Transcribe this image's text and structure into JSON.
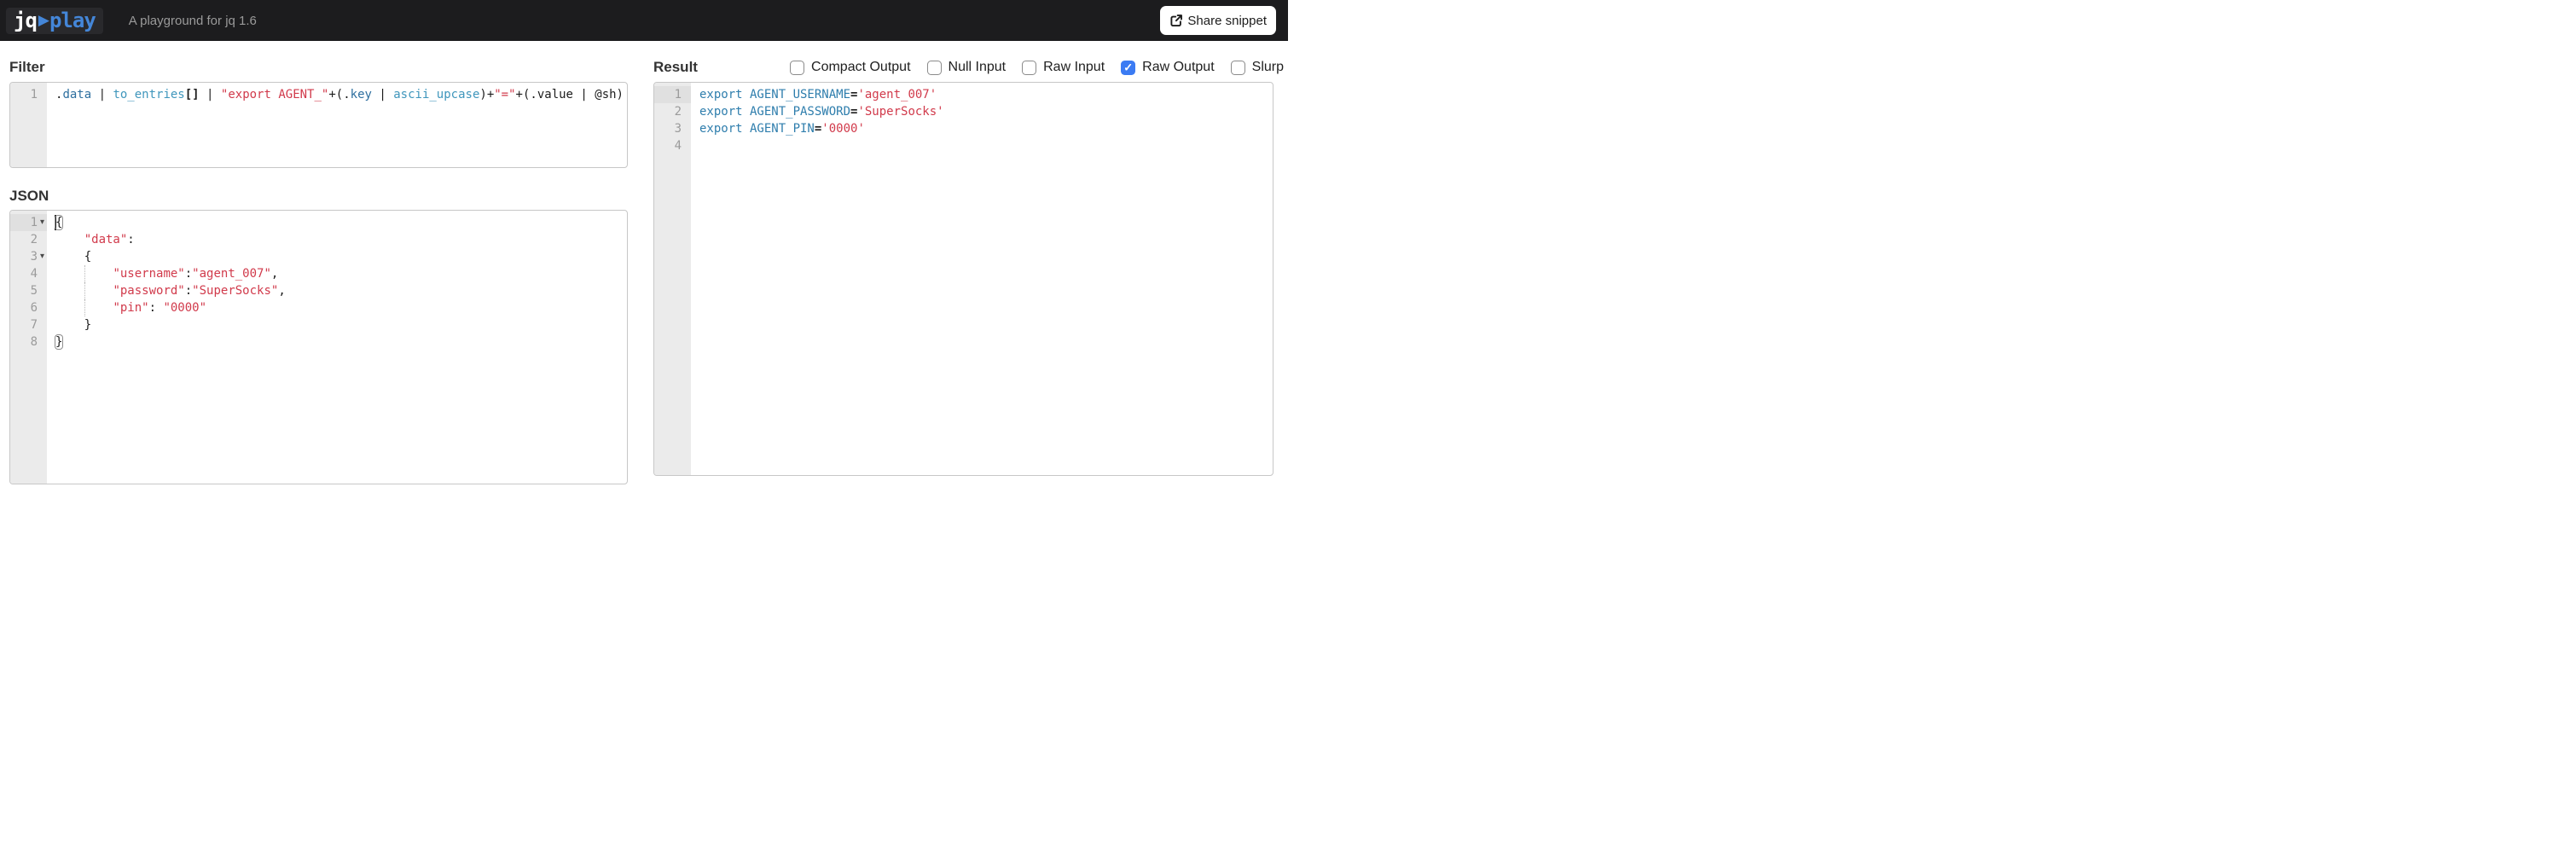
{
  "navbar": {
    "logo_jq": "jq",
    "logo_arrow": "▶",
    "logo_play": "play",
    "tagline": "A playground for jq 1.6",
    "share_button_label": "Share snippet"
  },
  "colors": {
    "navbar_bg": "#1c1c1e",
    "logo_blue": "#4486d8",
    "string_red": "#d13a4b",
    "field_blue": "#2e6f9f",
    "builtin_blue": "#3f96bc",
    "shell_blue": "#2f7ead",
    "checkbox_checked_blue": "#3b7bf3",
    "gutter_gray": "#ebebeb"
  },
  "filter": {
    "heading": "Filter",
    "editor": {
      "lines": [
        {
          "n": "1",
          "tokens": [
            {
              "t": ".",
              "c": ""
            },
            {
              "t": "data",
              "c": "b1"
            },
            {
              "t": " | ",
              "c": ""
            },
            {
              "t": "to_entries",
              "c": "b2"
            },
            {
              "t": "[]",
              "c": "bb"
            },
            {
              "t": " | ",
              "c": ""
            },
            {
              "t": "\"export AGENT_\"",
              "c": "r"
            },
            {
              "t": "+(.",
              "c": ""
            },
            {
              "t": "key",
              "c": "b1"
            },
            {
              "t": " | ",
              "c": ""
            },
            {
              "t": "ascii_upcase",
              "c": "b2"
            },
            {
              "t": ")+",
              "c": ""
            },
            {
              "t": "\"=\"",
              "c": "r"
            },
            {
              "t": "+(.value | @sh)",
              "c": ""
            }
          ]
        }
      ]
    }
  },
  "json_input": {
    "heading": "JSON",
    "editor": {
      "lines": [
        {
          "n": "1",
          "fold": true,
          "active": true,
          "cursor": true,
          "tokens": [
            {
              "t": "{",
              "c": "mb"
            }
          ]
        },
        {
          "n": "2",
          "tokens": [
            {
              "t": "    ",
              "c": ""
            },
            {
              "t": "\"data\"",
              "c": "r"
            },
            {
              "t": ":",
              "c": ""
            }
          ]
        },
        {
          "n": "3",
          "fold": true,
          "tokens": [
            {
              "t": "    {",
              "c": ""
            }
          ]
        },
        {
          "n": "4",
          "guide": true,
          "tokens": [
            {
              "t": "        ",
              "c": ""
            },
            {
              "t": "\"username\"",
              "c": "r"
            },
            {
              "t": ":",
              "c": ""
            },
            {
              "t": "\"agent_007\"",
              "c": "r"
            },
            {
              "t": ",",
              "c": ""
            }
          ]
        },
        {
          "n": "5",
          "guide": true,
          "tokens": [
            {
              "t": "        ",
              "c": ""
            },
            {
              "t": "\"password\"",
              "c": "r"
            },
            {
              "t": ":",
              "c": ""
            },
            {
              "t": "\"SuperSocks\"",
              "c": "r"
            },
            {
              "t": ",",
              "c": ""
            }
          ]
        },
        {
          "n": "6",
          "guide": true,
          "tokens": [
            {
              "t": "        ",
              "c": ""
            },
            {
              "t": "\"pin\"",
              "c": "r"
            },
            {
              "t": ": ",
              "c": ""
            },
            {
              "t": "\"0000\"",
              "c": "r"
            }
          ]
        },
        {
          "n": "7",
          "tokens": [
            {
              "t": "    }",
              "c": ""
            }
          ]
        },
        {
          "n": "8",
          "tokens": [
            {
              "t": "}",
              "c": "mb"
            }
          ]
        }
      ]
    }
  },
  "result": {
    "heading": "Result",
    "options": [
      {
        "label": "Compact Output",
        "checked": false
      },
      {
        "label": "Null Input",
        "checked": false
      },
      {
        "label": "Raw Input",
        "checked": false
      },
      {
        "label": "Raw Output",
        "checked": true
      },
      {
        "label": "Slurp",
        "checked": false
      }
    ],
    "editor": {
      "lines": [
        {
          "n": "1",
          "active": true,
          "tokens": [
            {
              "t": "export AGENT_USERNAME",
              "c": "sh"
            },
            {
              "t": "=",
              "c": "eq"
            },
            {
              "t": "'agent_007'",
              "c": "r"
            }
          ]
        },
        {
          "n": "2",
          "tokens": [
            {
              "t": "export AGENT_PASSWORD",
              "c": "sh"
            },
            {
              "t": "=",
              "c": "eq"
            },
            {
              "t": "'SuperSocks'",
              "c": "r"
            }
          ]
        },
        {
          "n": "3",
          "tokens": [
            {
              "t": "export AGENT_PIN",
              "c": "sh"
            },
            {
              "t": "=",
              "c": "eq"
            },
            {
              "t": "'0000'",
              "c": "r"
            }
          ]
        },
        {
          "n": "4",
          "tokens": []
        }
      ]
    }
  }
}
